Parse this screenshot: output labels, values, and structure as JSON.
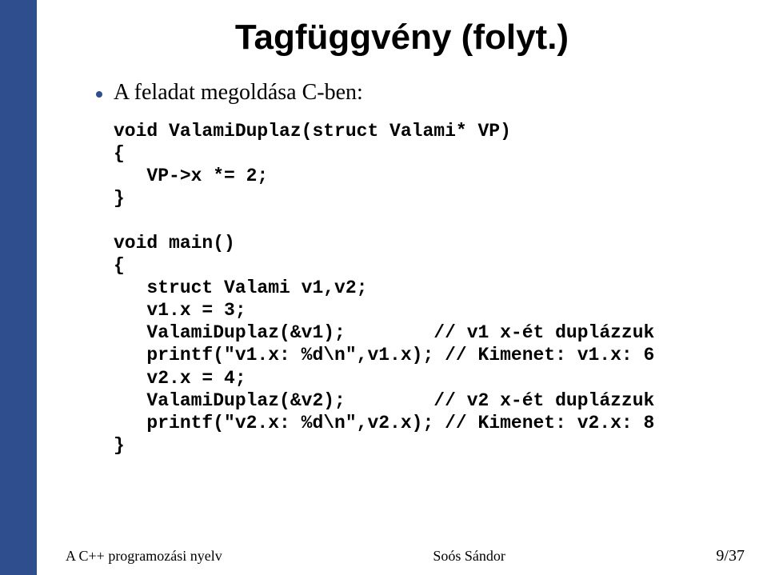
{
  "title": "Tagfüggvény (folyt.)",
  "bullet": "A feladat megoldása C-ben:",
  "code": {
    "fn_sig": "void ValamiDuplaz(struct Valami* VP)",
    "ob1": "{",
    "body1": "   VP->x *= 2;",
    "cb1": "}",
    "blank1": "",
    "main_sig": "void main()",
    "ob2": "{",
    "decl": "   struct Valami v1,v2;",
    "a1": "   v1.x = 3;",
    "a2_l": "   ValamiDuplaz(&v1);",
    "a2_r": "// v1 x-ét duplázzuk",
    "a3_l": "   printf(\"v1.x: %d\\n\",v1.x);",
    "a3_r": "// Kimenet: v1.x: 6",
    "a4": "   v2.x = 4;",
    "a5_l": "   ValamiDuplaz(&v2);",
    "a5_r": "// v2 x-ét duplázzuk",
    "a6_l": "   printf(\"v2.x: %d\\n\",v2.x);",
    "a6_r": "// Kimenet: v2.x: 8",
    "cb2": "}"
  },
  "footer": {
    "left": "A C++ programozási nyelv",
    "center": "Soós Sándor",
    "right": "9/37"
  }
}
